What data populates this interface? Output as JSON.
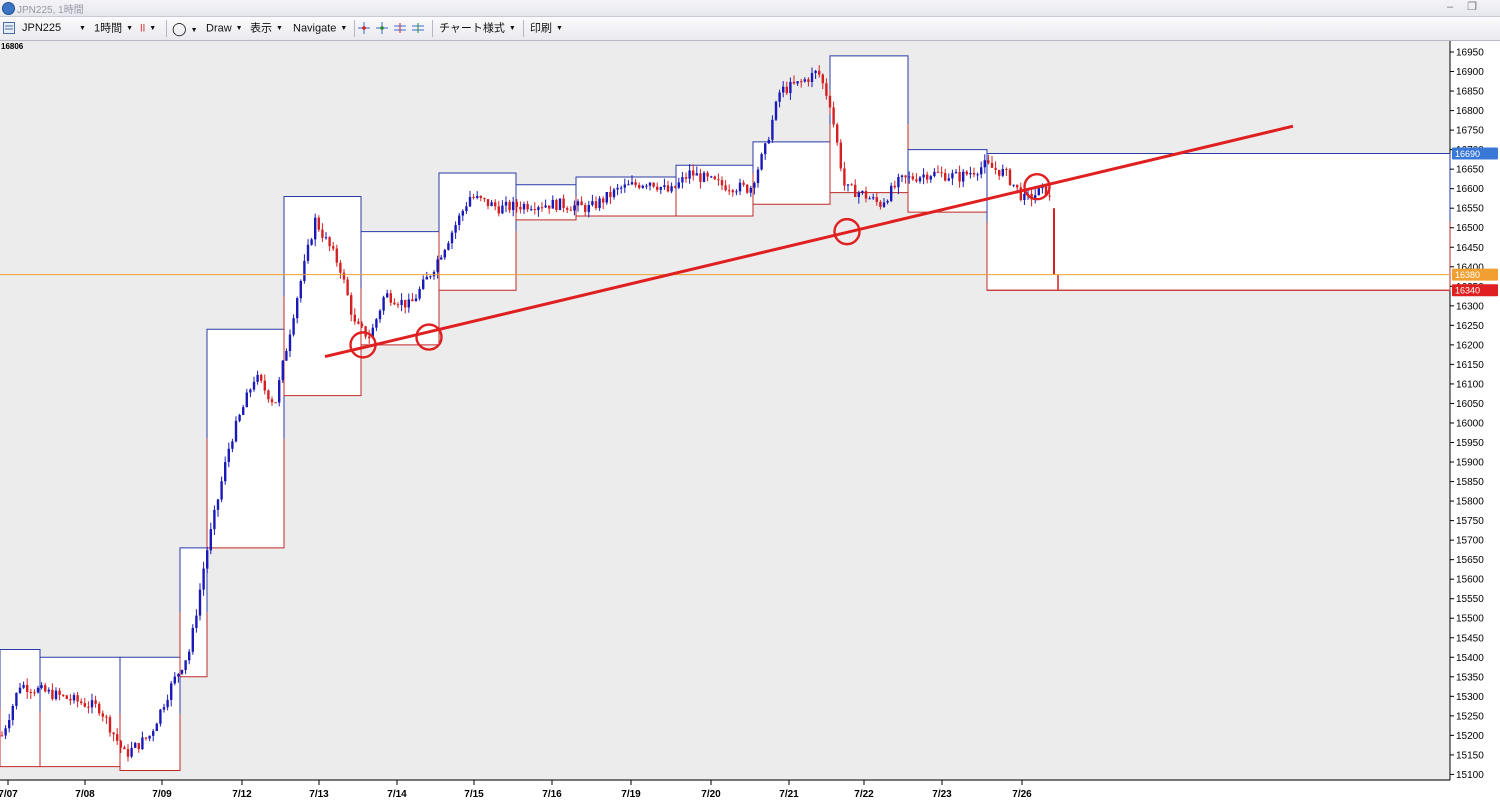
{
  "window": {
    "title": "JPN225, 1時間"
  },
  "toolbar": {
    "symbol": "JPN225",
    "timeframe": "1時間",
    "draw": "Draw",
    "display": "表示",
    "navigate": "Navigate",
    "chart_style": "チャート様式",
    "print": "印刷"
  },
  "chart": {
    "corner_value": "16806",
    "price_tag_blue": "16690",
    "price_tag_orange": "16380",
    "price_tag_red": "16340"
  },
  "colors": {
    "bull": "#1a1ab8",
    "bear": "#d42020",
    "box_top": "#2a3aa8",
    "box_bottom": "#c02828",
    "trendline": "#e02020",
    "hline": "#f0a030"
  },
  "chart_data": {
    "type": "candlestick",
    "yaxis": {
      "min": 15100,
      "max": 16950,
      "step": 50,
      "tick_labels": [
        "16950",
        "16900",
        "16850",
        "16800",
        "16750",
        "16700",
        "16650",
        "16600",
        "16550",
        "16500",
        "16450",
        "16400",
        "16350",
        "16300",
        "16250",
        "16200",
        "16150",
        "16100",
        "16050",
        "16000",
        "15950",
        "15900",
        "15850",
        "15800",
        "15750",
        "15700",
        "15650",
        "15600",
        "15550",
        "15500",
        "15450",
        "15400",
        "15350",
        "15300",
        "15250",
        "15200",
        "15150",
        "15100"
      ]
    },
    "xaxis": {
      "tick_labels": [
        "7/07",
        "7/08",
        "7/09",
        "7/12",
        "7/13",
        "7/14",
        "7/15",
        "7/16",
        "7/19",
        "7/20",
        "7/21",
        "7/22",
        "7/23",
        "7/26"
      ]
    },
    "daily_ranges": [
      {
        "date": "7/07",
        "high": 15420,
        "low": 15120
      },
      {
        "date": "7/08",
        "high": 15400,
        "low": 15120
      },
      {
        "date": "7/09",
        "high": 15400,
        "low": 15110
      },
      {
        "date": "7/09b",
        "high": 15680,
        "low": 15350
      },
      {
        "date": "7/12",
        "high": 16240,
        "low": 15680
      },
      {
        "date": "7/12b",
        "high": 16580,
        "low": 16070
      },
      {
        "date": "7/13",
        "high": 16490,
        "low": 16200
      },
      {
        "date": "7/14",
        "high": 16640,
        "low": 16340
      },
      {
        "date": "7/15",
        "high": 16610,
        "low": 16520
      },
      {
        "date": "7/16",
        "high": 16630,
        "low": 16530
      },
      {
        "date": "7/19",
        "high": 16660,
        "low": 16530
      },
      {
        "date": "7/20",
        "high": 16720,
        "low": 16560
      },
      {
        "date": "7/20b",
        "high": 16940,
        "low": 16590
      },
      {
        "date": "7/21",
        "high": 16850,
        "low": 16480
      },
      {
        "date": "7/22",
        "high": 16700,
        "low": 16540
      },
      {
        "date": "7/23",
        "high": 16780,
        "low": 16570
      },
      {
        "date": "7/26",
        "high": 16690,
        "low": 16340
      }
    ],
    "trendline": {
      "start": 16170,
      "end": 16760
    },
    "horizontal_lines": [
      {
        "level": 16690,
        "color": "blue"
      },
      {
        "level": 16380,
        "color": "orange"
      },
      {
        "level": 16340,
        "color": "red"
      }
    ],
    "touch_points": [
      16200,
      16220,
      16490,
      16605
    ]
  }
}
